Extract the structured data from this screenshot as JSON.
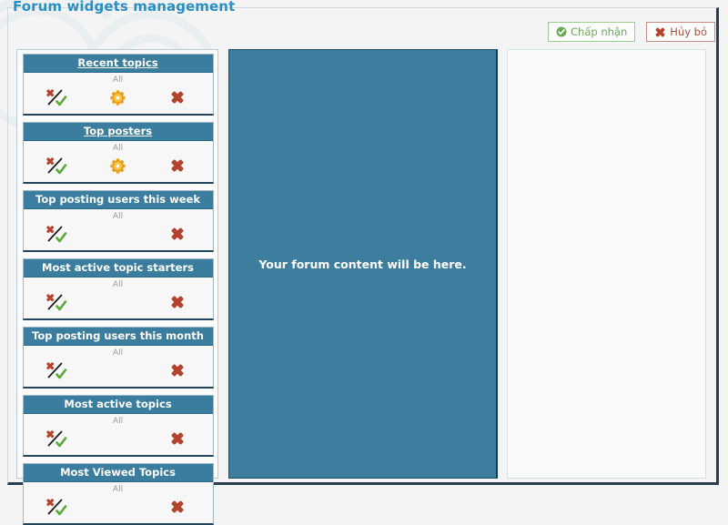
{
  "page": {
    "title": "Forum widgets management",
    "title_color": "#2a8fc4"
  },
  "toolbar": {
    "accept": {
      "label": "Chấp nhận",
      "icon": "check-circle-icon",
      "color": "#6aaa55"
    },
    "cancel": {
      "label": "Hủy bỏ",
      "icon": "x-mark-icon",
      "color": "#a8503f"
    }
  },
  "columns": {
    "left": {
      "name": "widgets-column",
      "widgets": [
        {
          "title": "Recent topics",
          "linked": true,
          "scope": "All",
          "actions": [
            "toggle-activation-icon",
            "configure-gear-icon",
            "delete-icon"
          ]
        },
        {
          "title": "Top posters",
          "linked": true,
          "scope": "All",
          "actions": [
            "toggle-activation-icon",
            "configure-gear-icon",
            "delete-icon"
          ]
        },
        {
          "title": "Top posting users this week",
          "linked": false,
          "scope": "All",
          "actions": [
            "toggle-activation-icon",
            "delete-icon"
          ]
        },
        {
          "title": "Most active topic starters",
          "linked": false,
          "scope": "All",
          "actions": [
            "toggle-activation-icon",
            "delete-icon"
          ]
        },
        {
          "title": "Top posting users this month",
          "linked": false,
          "scope": "All",
          "actions": [
            "toggle-activation-icon",
            "delete-icon"
          ]
        },
        {
          "title": "Most active topics",
          "linked": false,
          "scope": "All",
          "actions": [
            "toggle-activation-icon",
            "delete-icon"
          ]
        },
        {
          "title": "Most Viewed Topics",
          "linked": false,
          "scope": "All",
          "actions": [
            "toggle-activation-icon",
            "delete-icon"
          ]
        }
      ]
    },
    "center": {
      "name": "forum-content-placeholder",
      "text": "Your forum content will be here.",
      "background": "#3d7e9e"
    },
    "right": {
      "name": "right-widgets-dropzone",
      "widgets": []
    }
  }
}
